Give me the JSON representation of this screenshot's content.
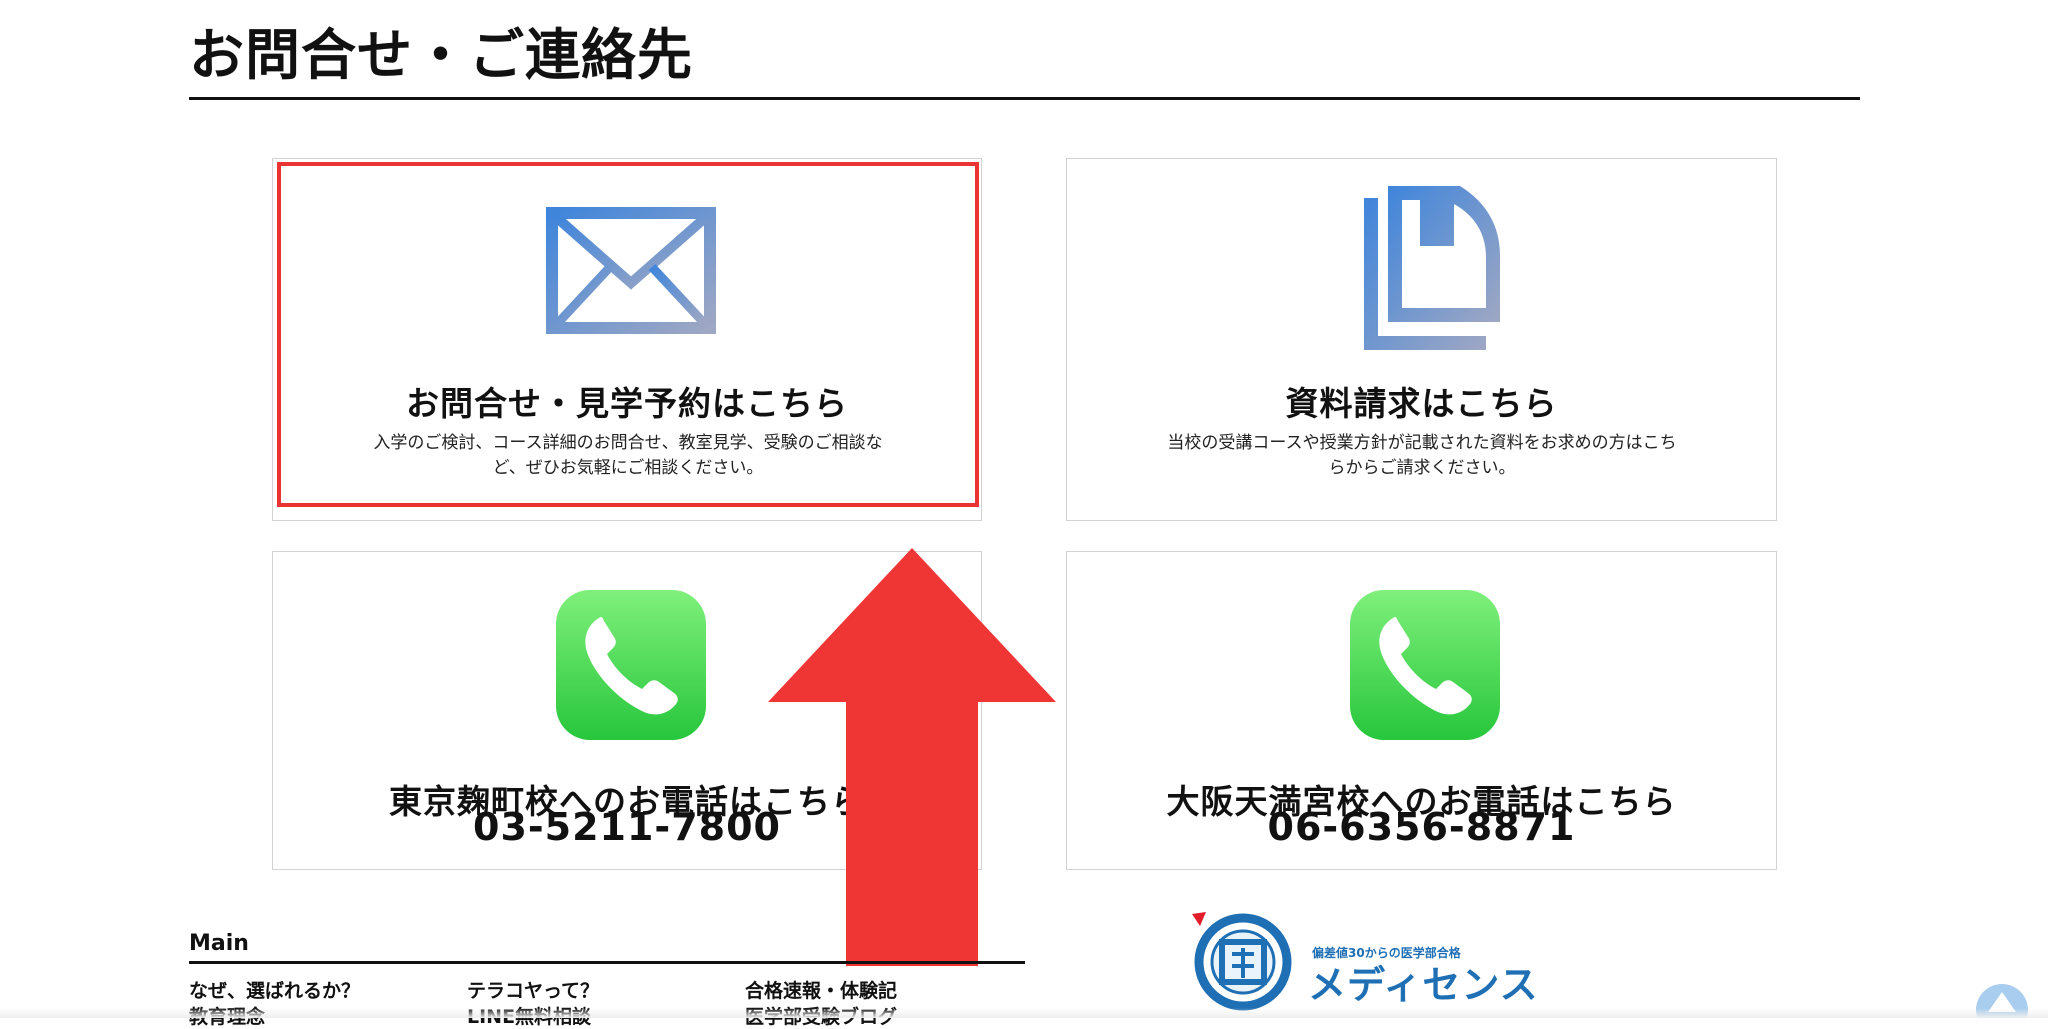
{
  "section": {
    "title": "お問合せ・ご連絡先"
  },
  "cards": [
    {
      "icon": "mail-icon",
      "title": "お問合せ・見学予約はこちら",
      "description": "入学のご検討、コース詳細のお問合せ、教室見学、受験のご相談など、ぜひお気軽にご相談ください。"
    },
    {
      "icon": "document-icon",
      "title": "資料請求はこちら",
      "description": "当校の受講コースや授業方針が記載された資料をお求めの方はこちらからご請求ください。"
    },
    {
      "icon": "phone-icon",
      "title": "東京麹町校へのお電話はこちら",
      "phone": "03-5211-7800"
    },
    {
      "icon": "phone-icon",
      "title": "大阪天満宮校へのお電話はこちら",
      "phone": "06-6356-8871"
    }
  ],
  "annotation": {
    "icon": "red-up-arrow-icon",
    "color": "#f03535",
    "highlight_color": "#ea3333"
  },
  "footer": {
    "menu_title": "Main",
    "links": [
      "なぜ、選ばれるか？",
      "テラコヤって？",
      "合格速報・体験記",
      "教育理念",
      "LINE無料相談",
      "医学部受験ブログ"
    ]
  },
  "logo": {
    "tagline": "偏差値30からの医学部合格",
    "name": "メディセンス"
  },
  "colors": {
    "icon_gradient_start": "#3f85db",
    "icon_gradient_end": "#9ea7c3",
    "phone_green_top": "#7ff07b",
    "phone_green_bottom": "#27c63c",
    "logo_blue": "#1f6fb5"
  }
}
